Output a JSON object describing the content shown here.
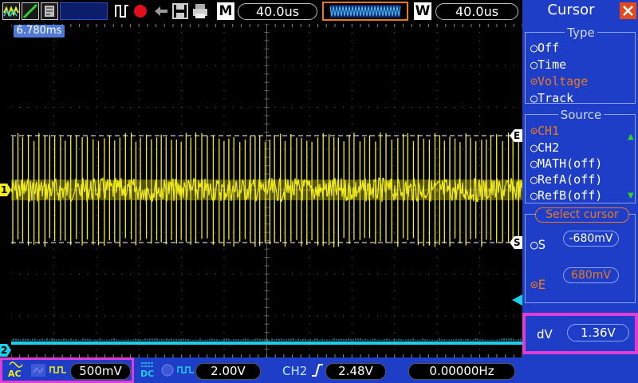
{
  "top_bar": {
    "mode_label": "M",
    "time_base": "40.0us",
    "window_label": "W",
    "window_time_base": "40.0us",
    "icons": [
      "waveform-run-icon",
      "waveform-view-icon",
      "waveform-persist-icon",
      "run-stop-icon",
      "record-icon",
      "pointer-icon",
      "save-icon",
      "print-icon"
    ]
  },
  "plot": {
    "trigger_time_label": "6.780ms",
    "ch1_marker": "1",
    "ch2_marker": "2",
    "cursor_e_label": "E",
    "cursor_s_label": "S",
    "colors": {
      "ch1": "#f2ec1a",
      "ch2": "#1ecde8",
      "grid": "#6a6a6a",
      "cursor": "#ffffff"
    }
  },
  "panel": {
    "title": "Cursor",
    "type_group": {
      "title": "Type",
      "options": [
        "Off",
        "Time",
        "Voltage",
        "Track"
      ],
      "selected": "Voltage"
    },
    "source_group": {
      "title": "Source",
      "options": [
        "CH1",
        "CH2",
        "MATH(off)",
        "RefA(off)",
        "RefB(off)"
      ],
      "selected": "CH1"
    },
    "select_cursor": {
      "title": "Select cursor",
      "s_label": "S",
      "s_value": "-680mV",
      "e_label": "E",
      "e_value": "680mV",
      "selected": "E"
    },
    "dv_label": "dV",
    "dv_value": "1.36V"
  },
  "bottom_bar": {
    "ch1_coupling": "AC",
    "ch1_scale": "500mV",
    "ch2_coupling": "DC",
    "ch2_scale": "2.00V",
    "trigger_channel": "CH2",
    "trigger_level": "2.48V",
    "frequency": "0.00000Hz"
  }
}
